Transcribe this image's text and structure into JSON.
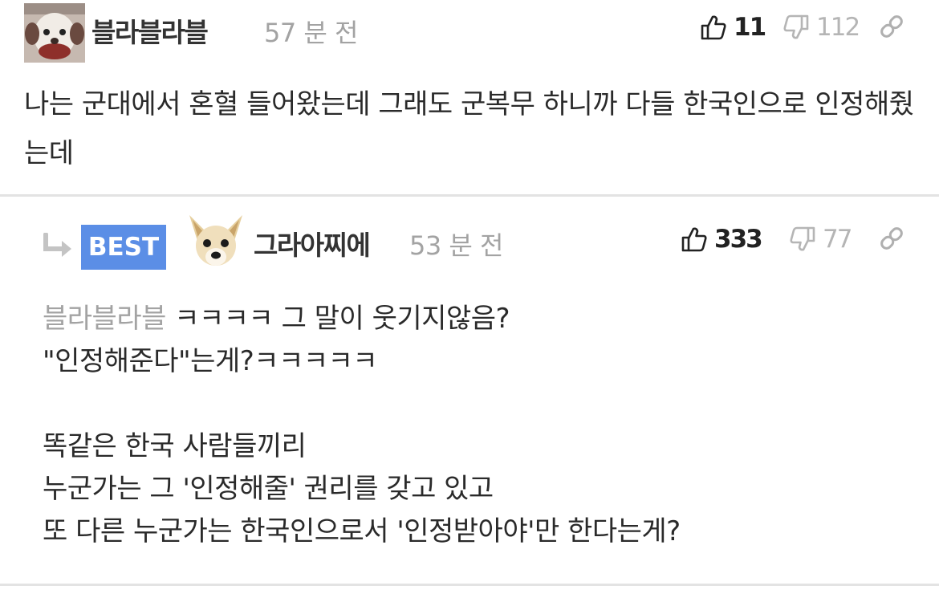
{
  "comments": [
    {
      "author": "블라블라블",
      "time": "57 분 전",
      "likes": "11",
      "dislikes": "112",
      "text": "나는 군대에서 혼혈 들어왔는데 그래도 군복무 하니까 다들 한국인으로 인정해줬는데"
    },
    {
      "badge": "BEST",
      "author": "그라아찌에",
      "time": "53 분 전",
      "likes": "333",
      "dislikes": "77",
      "mention": "블라블라블",
      "lines": [
        "ㅋㅋㅋㅋ 그 말이 웃기지않음?",
        "\"인정해준다\"는게?ㅋㅋㅋㅋㅋ",
        "",
        "똑같은 한국 사람들끼리",
        "누군가는 그 '인정해줄' 권리를 갖고 있고",
        "또 다른 누군가는 한국인으로서 '인정받아야'만 한다는게?"
      ]
    }
  ],
  "colors": {
    "best_badge": "#5b8ee6",
    "muted_text": "#a3a3a3",
    "divider": "#e3e3e3"
  },
  "icons": [
    "thumbs-up-icon",
    "thumbs-down-icon",
    "link-icon",
    "reply-arrow-icon"
  ]
}
